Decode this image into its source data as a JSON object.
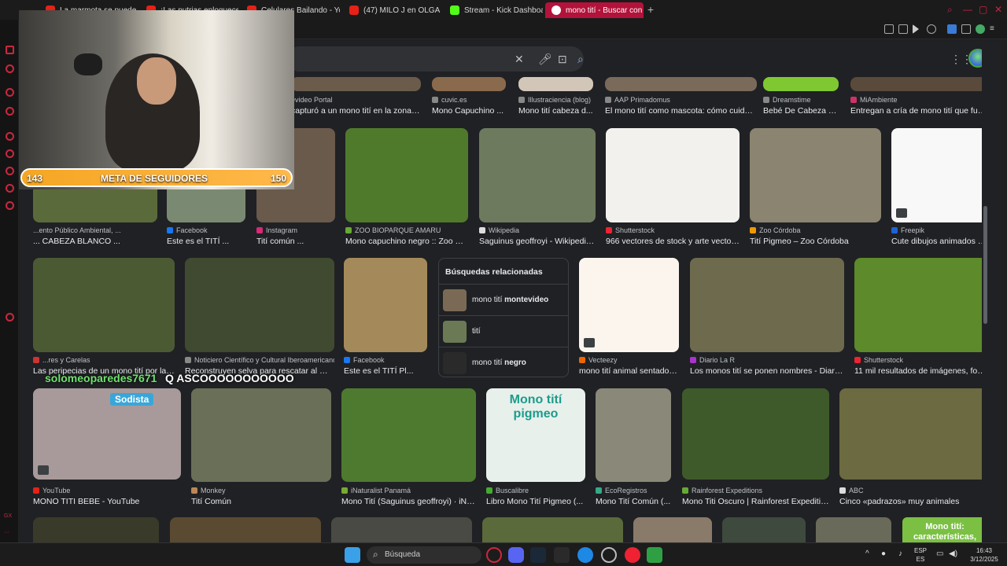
{
  "browser": {
    "tabs": [
      {
        "label": "La marmota se puede lirro..."
      },
      {
        "label": "¡Las nutrias enloquecen..."
      },
      {
        "label": "Celulares Bailando - YouT..."
      },
      {
        "label": "(47) MILO J en OLGA: AN..."
      },
      {
        "label": "Stream - Kick Dashboard"
      },
      {
        "label": "mono tití - Buscar con Go..."
      }
    ],
    "new_tab": "+"
  },
  "search": {
    "placeholder": "",
    "clear_icon": "✕"
  },
  "results": [
    {
      "source": "evideo Portal",
      "title": "capturó a un mono tití en la zona d...",
      "color": "#6b5b4b"
    },
    {
      "source": "cuvic.es",
      "title": "Mono Capuchino ...",
      "color": "#8a6a4d"
    },
    {
      "source": "Illustraciencia (blog)",
      "title": "Mono tití cabeza d...",
      "color": "#d2c6b8"
    },
    {
      "source": "AAP Primadomus",
      "title": "El mono tití como mascota: cómo cuidar ...",
      "color": "#7a6a5a"
    },
    {
      "source": "Dreamstime",
      "title": "Bebé De Cabeza B...",
      "color": "#7fc832"
    },
    {
      "source": "MiAmbiente",
      "title": "Entregan a cría de mono tití que fue r...",
      "color": "#5a4a3c"
    },
    {
      "source": "...ento Público Ambiental, ...",
      "title": "... CABEZA BLANCO ...",
      "color": "#5b6a3a"
    },
    {
      "source": "Facebook",
      "title": "Este es el TITÍ ...",
      "color": "#7a8a72"
    },
    {
      "source": "Instagram",
      "title": "Tití común ...",
      "color": "#6a5a4c"
    },
    {
      "source": "ZOO BIOPARQUE AMARU",
      "title": "Mono capuchino negro :: Zoo Bio...",
      "color": "#4f7a2c"
    },
    {
      "source": "Wikipedia",
      "title": "Saguinus geoffroyi - Wikipedia,...",
      "color": "#6d7a5e"
    },
    {
      "source": "Shutterstock",
      "title": "966 vectores de stock y arte vectori...",
      "color": "#f3f1ee"
    },
    {
      "source": "Zoo Córdoba",
      "title": "Tití Pigmeo – Zoo Córdoba",
      "color": "#8a8470"
    },
    {
      "source": "Freepik",
      "title": "Cute dibujos animados d...",
      "color": "#f8f8f8"
    },
    {
      "source": "...res y Carelas",
      "title": "Las peripecias de un mono tití por las ...",
      "color": "#4c5a34"
    },
    {
      "source": "Noticiero Científico y Cultural Iberoamericano",
      "title": "Reconstruyen selva para rescatar al Mo...",
      "color": "#3f4a30"
    },
    {
      "source": "Facebook",
      "title": "Este es el TITÍ Pl...",
      "color": "#a48a5a"
    },
    {
      "source": "Vecteezy",
      "title": "mono tití animal sentado 1...",
      "color": "#fbf5ee"
    },
    {
      "source": "Diario La R",
      "title": "Los monos tití se ponen nombres - Diario ...",
      "color": "#6e6a4e"
    },
    {
      "source": "Shutterstock",
      "title": "11 mil resultados de imágenes, foto...",
      "color": "#5d8a2a"
    },
    {
      "source": "YouTube",
      "title": "MONO TITI BEBE - YouTube",
      "color": "#a89a9a"
    },
    {
      "source": "Monkey",
      "title": "Tití Común",
      "color": "#6a7058"
    },
    {
      "source": "iNaturalist Panamá",
      "title": "Mono Tití (Saguinus geoffroyi) · iNat...",
      "color": "#4e7a30"
    },
    {
      "source": "Buscalibre",
      "title": "Libro Mono Tití Pigmeo (...",
      "color": "#e8f0ec"
    },
    {
      "source": "EcoRegistros",
      "title": "Mono Tití Común (...",
      "color": "#8a8878"
    },
    {
      "source": "Rainforest Expeditions",
      "title": "Mono Titi Oscuro | Rainforest Expeditions",
      "color": "#3e5a2a"
    },
    {
      "source": "ABC",
      "title": "Cinco «padrazos» muy animales",
      "color": "#6b6a40"
    }
  ],
  "related": {
    "title": "Búsquedas relacionadas",
    "items": [
      {
        "prefix": "mono tití",
        "bold": "montevideo"
      },
      {
        "prefix": "tití",
        "bold": ""
      },
      {
        "prefix": "mono tití",
        "bold": "negro"
      }
    ]
  },
  "book_card": "Mono tití pigmeo",
  "bottom_card": "Mono tití: características,",
  "stream": {
    "goal_label": "META DE SEGUIDORES",
    "goal_current": "143",
    "goal_target": "150",
    "goal_progress": 0.953,
    "chat_user": "solomeoparedes7671",
    "chat_message": "Q ASCOOOOOOOOOOO",
    "sodista_text": "Sodista"
  },
  "taskbar": {
    "search_label": "Búsqueda",
    "lang_top": "ESP",
    "lang_bottom": "ES",
    "time": "16:43",
    "date": "3/12/2025"
  },
  "colors": {
    "accent": "#b3123a",
    "page_bg": "#202124",
    "goal_bar": "#f5a623"
  }
}
